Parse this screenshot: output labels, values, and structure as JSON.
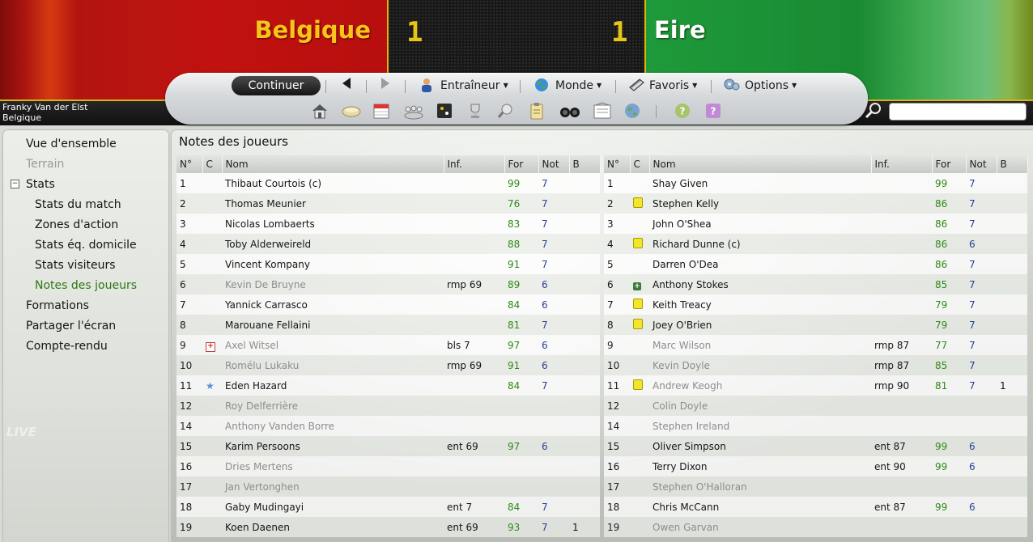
{
  "match": {
    "home_team": "Belgique",
    "away_team": "Eire",
    "home_score": "1",
    "away_score": "1"
  },
  "manager": {
    "name": "Franky Van der Elst",
    "team": "Belgique"
  },
  "toolbar": {
    "continue": "Continuer",
    "entraineur": "Entraîneur",
    "monde": "Monde",
    "favoris": "Favoris",
    "options": "Options"
  },
  "search": {
    "placeholder": ""
  },
  "sidebar": {
    "items": [
      "Vue d'ensemble",
      "Terrain",
      "Stats",
      "Stats du match",
      "Zones d'action",
      "Stats éq. domicile",
      "Stats visiteurs",
      "Notes des joueurs",
      "Formations",
      "Partager l'écran",
      "Compte-rendu"
    ],
    "watermark": "LIVE"
  },
  "panel": {
    "title": "Notes des joueurs"
  },
  "columns": [
    "N°",
    "C",
    "Nom",
    "Inf.",
    "For",
    "Not",
    "B"
  ],
  "home_players": [
    {
      "n": "1",
      "c": "",
      "name": "Thibaut Courtois (c)",
      "inf": "",
      "for": "99",
      "not": "7",
      "b": "",
      "sub": false
    },
    {
      "n": "2",
      "c": "",
      "name": "Thomas Meunier",
      "inf": "",
      "for": "76",
      "not": "7",
      "b": "",
      "sub": false
    },
    {
      "n": "3",
      "c": "",
      "name": "Nicolas Lombaerts",
      "inf": "",
      "for": "83",
      "not": "7",
      "b": "",
      "sub": false
    },
    {
      "n": "4",
      "c": "",
      "name": "Toby Alderweireld",
      "inf": "",
      "for": "88",
      "not": "7",
      "b": "",
      "sub": false
    },
    {
      "n": "5",
      "c": "",
      "name": "Vincent Kompany",
      "inf": "",
      "for": "91",
      "not": "7",
      "b": "",
      "sub": false
    },
    {
      "n": "6",
      "c": "",
      "name": "Kevin De Bruyne",
      "inf": "rmp 69",
      "for": "89",
      "not": "6",
      "b": "",
      "sub": true
    },
    {
      "n": "7",
      "c": "",
      "name": "Yannick Carrasco",
      "inf": "",
      "for": "84",
      "not": "6",
      "b": "",
      "sub": false
    },
    {
      "n": "8",
      "c": "",
      "name": "Marouane Fellaini",
      "inf": "",
      "for": "81",
      "not": "7",
      "b": "",
      "sub": false
    },
    {
      "n": "9",
      "c": "injury",
      "name": "Axel Witsel",
      "inf": "bls 7",
      "for": "97",
      "not": "6",
      "b": "",
      "sub": true
    },
    {
      "n": "10",
      "c": "",
      "name": "Romélu Lukaku",
      "inf": "rmp 69",
      "for": "91",
      "not": "6",
      "b": "",
      "sub": true
    },
    {
      "n": "11",
      "c": "star",
      "name": "Eden Hazard",
      "inf": "",
      "for": "84",
      "not": "7",
      "b": "",
      "sub": false
    },
    {
      "n": "12",
      "c": "",
      "name": "Roy Delferrière",
      "inf": "",
      "for": "",
      "not": "",
      "b": "",
      "sub": true
    },
    {
      "n": "14",
      "c": "",
      "name": "Anthony Vanden Borre",
      "inf": "",
      "for": "",
      "not": "",
      "b": "",
      "sub": true
    },
    {
      "n": "15",
      "c": "",
      "name": "Karim Persoons",
      "inf": "ent 69",
      "for": "97",
      "not": "6",
      "b": "",
      "sub": false
    },
    {
      "n": "16",
      "c": "",
      "name": "Dries Mertens",
      "inf": "",
      "for": "",
      "not": "",
      "b": "",
      "sub": true
    },
    {
      "n": "17",
      "c": "",
      "name": "Jan Vertonghen",
      "inf": "",
      "for": "",
      "not": "",
      "b": "",
      "sub": true
    },
    {
      "n": "18",
      "c": "",
      "name": "Gaby Mudingayi",
      "inf": "ent 7",
      "for": "84",
      "not": "7",
      "b": "",
      "sub": false
    },
    {
      "n": "19",
      "c": "",
      "name": "Koen Daenen",
      "inf": "ent 69",
      "for": "93",
      "not": "7",
      "b": "1",
      "sub": false
    }
  ],
  "away_players": [
    {
      "n": "1",
      "c": "",
      "name": "Shay Given",
      "inf": "",
      "for": "99",
      "not": "7",
      "b": "",
      "sub": false
    },
    {
      "n": "2",
      "c": "yellow",
      "name": "Stephen Kelly",
      "inf": "",
      "for": "86",
      "not": "7",
      "b": "",
      "sub": false
    },
    {
      "n": "3",
      "c": "",
      "name": "John O'Shea",
      "inf": "",
      "for": "86",
      "not": "7",
      "b": "",
      "sub": false
    },
    {
      "n": "4",
      "c": "yellow",
      "name": "Richard Dunne (c)",
      "inf": "",
      "for": "86",
      "not": "6",
      "b": "",
      "sub": false
    },
    {
      "n": "5",
      "c": "",
      "name": "Darren O'Dea",
      "inf": "",
      "for": "86",
      "not": "7",
      "b": "",
      "sub": false
    },
    {
      "n": "6",
      "c": "plus",
      "name": "Anthony Stokes",
      "inf": "",
      "for": "85",
      "not": "7",
      "b": "",
      "sub": false
    },
    {
      "n": "7",
      "c": "yellow",
      "name": "Keith Treacy",
      "inf": "",
      "for": "79",
      "not": "7",
      "b": "",
      "sub": false
    },
    {
      "n": "8",
      "c": "yellow",
      "name": "Joey O'Brien",
      "inf": "",
      "for": "79",
      "not": "7",
      "b": "",
      "sub": false
    },
    {
      "n": "9",
      "c": "",
      "name": "Marc Wilson",
      "inf": "rmp 87",
      "for": "77",
      "not": "7",
      "b": "",
      "sub": true
    },
    {
      "n": "10",
      "c": "",
      "name": "Kevin Doyle",
      "inf": "rmp 87",
      "for": "85",
      "not": "7",
      "b": "",
      "sub": true
    },
    {
      "n": "11",
      "c": "yellow",
      "name": "Andrew Keogh",
      "inf": "rmp 90",
      "for": "81",
      "not": "7",
      "b": "1",
      "sub": true
    },
    {
      "n": "12",
      "c": "",
      "name": "Colin Doyle",
      "inf": "",
      "for": "",
      "not": "",
      "b": "",
      "sub": true
    },
    {
      "n": "14",
      "c": "",
      "name": "Stephen Ireland",
      "inf": "",
      "for": "",
      "not": "",
      "b": "",
      "sub": true
    },
    {
      "n": "15",
      "c": "",
      "name": "Oliver Simpson",
      "inf": "ent 87",
      "for": "99",
      "not": "6",
      "b": "",
      "sub": false
    },
    {
      "n": "16",
      "c": "",
      "name": "Terry Dixon",
      "inf": "ent 90",
      "for": "99",
      "not": "6",
      "b": "",
      "sub": false
    },
    {
      "n": "17",
      "c": "",
      "name": "Stephen O'Halloran",
      "inf": "",
      "for": "",
      "not": "",
      "b": "",
      "sub": true
    },
    {
      "n": "18",
      "c": "",
      "name": "Chris McCann",
      "inf": "ent 87",
      "for": "99",
      "not": "6",
      "b": "",
      "sub": false
    },
    {
      "n": "19",
      "c": "",
      "name": "Owen Garvan",
      "inf": "",
      "for": "",
      "not": "",
      "b": "",
      "sub": true
    }
  ]
}
